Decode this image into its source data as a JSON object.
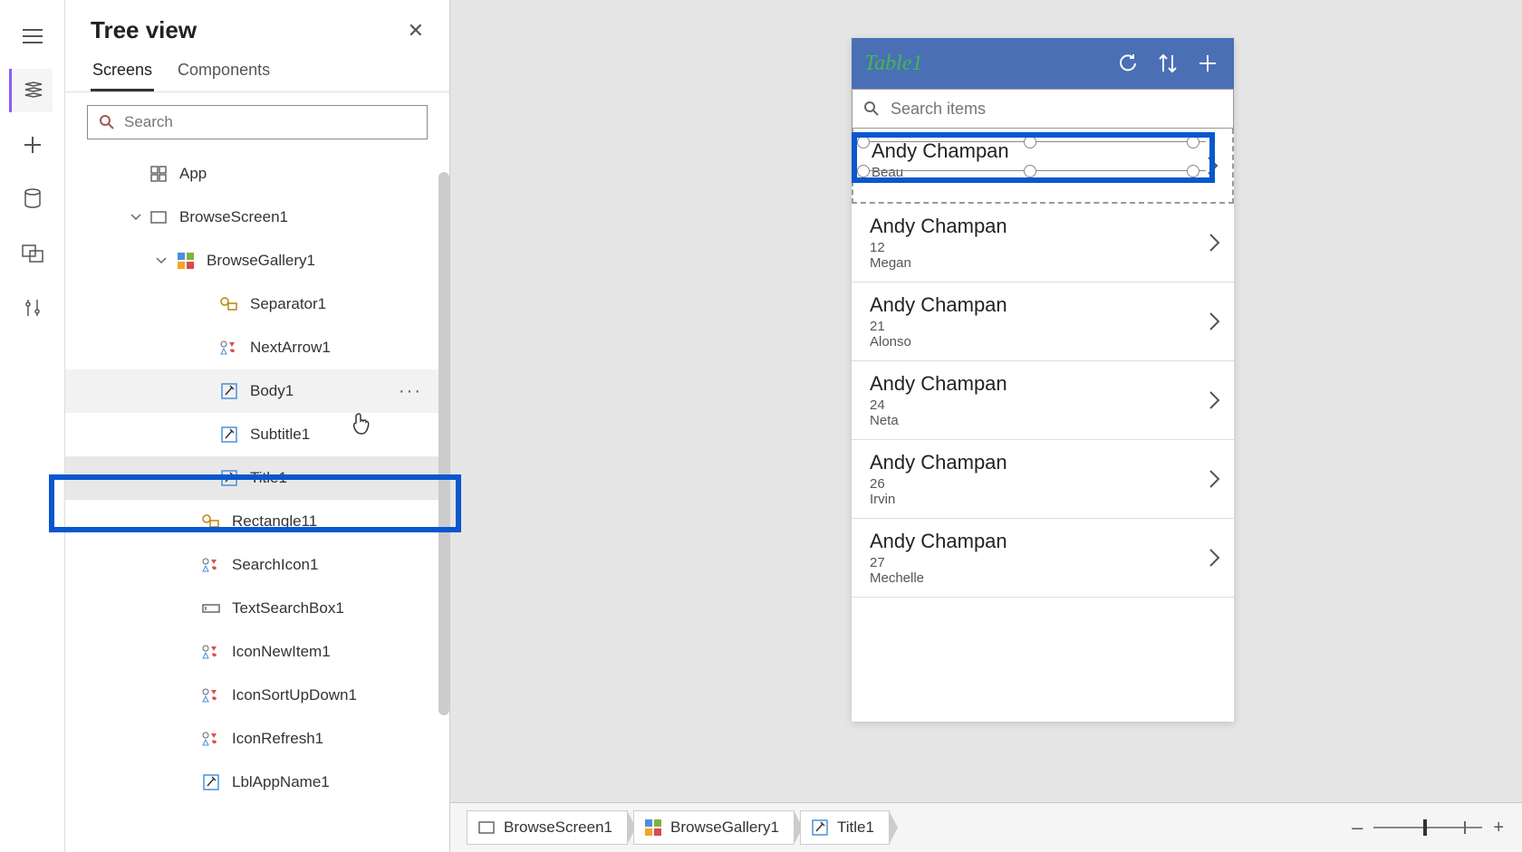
{
  "panel": {
    "title": "Tree view",
    "tabs": [
      "Screens",
      "Components"
    ],
    "search_placeholder": "Search"
  },
  "tree": {
    "root": "App",
    "screen": "BrowseScreen1",
    "gallery": "BrowseGallery1",
    "items": [
      "Separator1",
      "NextArrow1",
      "Body1",
      "Subtitle1",
      "Title1",
      "Rectangle11",
      "SearchIcon1",
      "TextSearchBox1",
      "IconNewItem1",
      "IconSortUpDown1",
      "IconRefresh1",
      "LblAppName1"
    ]
  },
  "preview": {
    "app_title": "Table1",
    "search_placeholder": "Search items",
    "rows": [
      {
        "title": "Andy Champan",
        "sub": "",
        "body": "Beau"
      },
      {
        "title": "Andy Champan",
        "sub": "12",
        "body": "Megan"
      },
      {
        "title": "Andy Champan",
        "sub": "21",
        "body": "Alonso"
      },
      {
        "title": "Andy Champan",
        "sub": "24",
        "body": "Neta"
      },
      {
        "title": "Andy Champan",
        "sub": "26",
        "body": "Irvin"
      },
      {
        "title": "Andy Champan",
        "sub": "27",
        "body": "Mechelle"
      }
    ]
  },
  "breadcrumb": [
    "BrowseScreen1",
    "BrowseGallery1",
    "Title1"
  ],
  "zoom": {
    "minus": "–",
    "plus": "+"
  }
}
